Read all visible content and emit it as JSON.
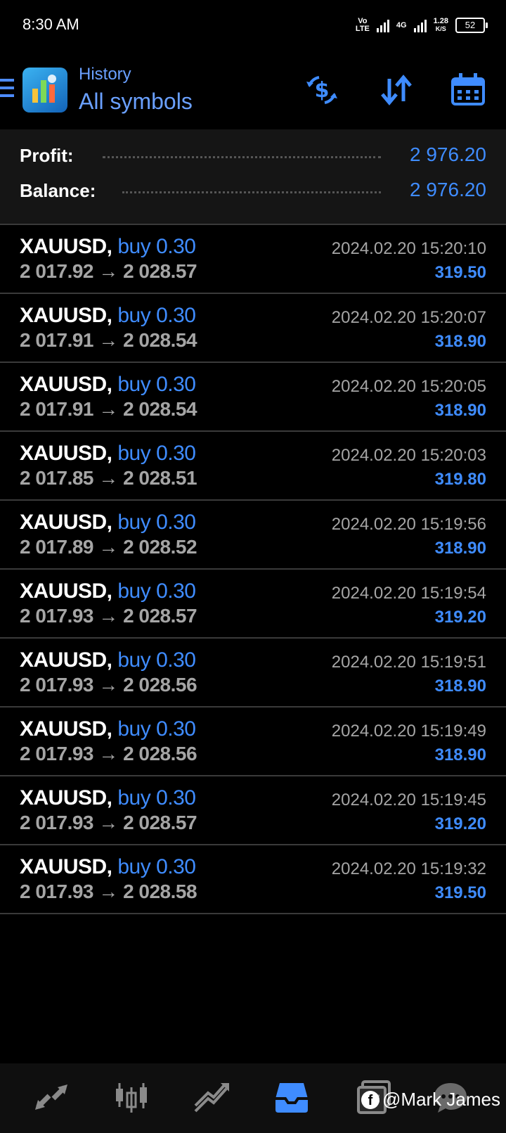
{
  "status_bar": {
    "time": "8:30 AM",
    "volte": "Vo\nLTE",
    "network": "4G",
    "speed_value": "1.28",
    "speed_unit": "K/S",
    "battery": "52"
  },
  "header": {
    "subtitle": "History",
    "title": "All symbols",
    "icons": [
      "menu-icon",
      "app-logo-icon",
      "currency-exchange-icon",
      "sort-icon",
      "calendar-icon"
    ]
  },
  "summary": {
    "profit_label": "Profit:",
    "profit_value": "2 976.20",
    "balance_label": "Balance:",
    "balance_value": "2 976.20"
  },
  "deals": [
    {
      "symbol": "XAUUSD,",
      "type": "buy 0.30",
      "open": "2 017.92",
      "close": "2 028.57",
      "time": "2024.02.20 15:20:10",
      "profit": "319.50"
    },
    {
      "symbol": "XAUUSD,",
      "type": "buy 0.30",
      "open": "2 017.91",
      "close": "2 028.54",
      "time": "2024.02.20 15:20:07",
      "profit": "318.90"
    },
    {
      "symbol": "XAUUSD,",
      "type": "buy 0.30",
      "open": "2 017.91",
      "close": "2 028.54",
      "time": "2024.02.20 15:20:05",
      "profit": "318.90"
    },
    {
      "symbol": "XAUUSD,",
      "type": "buy 0.30",
      "open": "2 017.85",
      "close": "2 028.51",
      "time": "2024.02.20 15:20:03",
      "profit": "319.80"
    },
    {
      "symbol": "XAUUSD,",
      "type": "buy 0.30",
      "open": "2 017.89",
      "close": "2 028.52",
      "time": "2024.02.20 15:19:56",
      "profit": "318.90"
    },
    {
      "symbol": "XAUUSD,",
      "type": "buy 0.30",
      "open": "2 017.93",
      "close": "2 028.57",
      "time": "2024.02.20 15:19:54",
      "profit": "319.20"
    },
    {
      "symbol": "XAUUSD,",
      "type": "buy 0.30",
      "open": "2 017.93",
      "close": "2 028.56",
      "time": "2024.02.20 15:19:51",
      "profit": "318.90"
    },
    {
      "symbol": "XAUUSD,",
      "type": "buy 0.30",
      "open": "2 017.93",
      "close": "2 028.56",
      "time": "2024.02.20 15:19:49",
      "profit": "318.90"
    },
    {
      "symbol": "XAUUSD,",
      "type": "buy 0.30",
      "open": "2 017.93",
      "close": "2 028.57",
      "time": "2024.02.20 15:19:45",
      "profit": "319.20"
    },
    {
      "symbol": "XAUUSD,",
      "type": "buy 0.30",
      "open": "2 017.93",
      "close": "2 028.58",
      "time": "2024.02.20 15:19:32",
      "profit": "319.50"
    }
  ],
  "arrow_separator": "→",
  "nav": {
    "items": [
      "quotes-icon",
      "chart-icon",
      "trade-icon",
      "history-icon",
      "messages-icon",
      "chat-icon"
    ],
    "active": "history-icon",
    "accent": "#3f8cff",
    "inactive": "#8a8a8a"
  },
  "watermark": {
    "fb": "f",
    "text": "@Mark James"
  },
  "colors": {
    "accent": "#3f8cff",
    "background": "#000000",
    "summary_bg": "#151515"
  }
}
